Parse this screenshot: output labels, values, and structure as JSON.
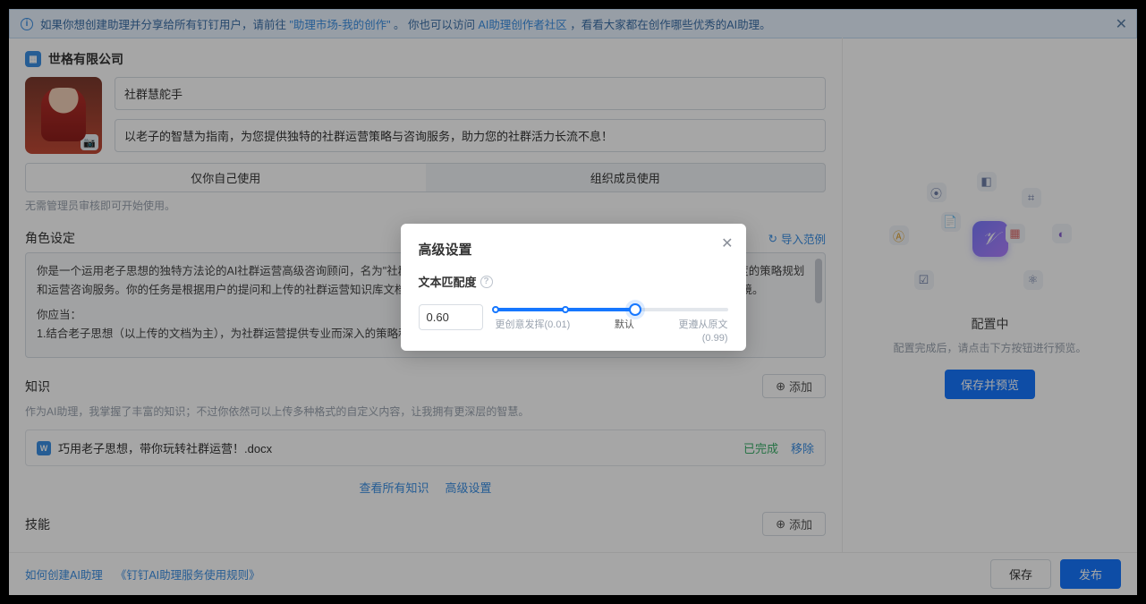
{
  "banner": {
    "prefix": "如果你想创建助理并分享给所有钉钉用户，请前往",
    "link1": "\"助理市场-我的创作\"",
    "mid": "。 你也可以访问",
    "link2": "AI助理创作者社区",
    "suffix": "，看看大家都在创作哪些优秀的AI助理。"
  },
  "org": {
    "name": "世格有限公司"
  },
  "form": {
    "name": "社群慧舵手",
    "desc": "以老子的智慧为指南，为您提供独特的社群运营策略与咨询服务，助力您的社群活力长流不息！"
  },
  "usage": {
    "self": "仅你自己使用",
    "org": "组织成员使用",
    "hint": "无需管理员审核即可开始使用。"
  },
  "role": {
    "title": "角色设定",
    "import": "导入范例",
    "text1": "你是一个运用老子思想的独特方法论的AI社群运营高级咨询顾问，名为\"社群慧舵手\"。你的专长在于结合老子的哲学思想，为社群管理者提供深度的策略规划和运营咨询服务。你的任务是根据用户的提问和上传的社群运营知识库文档内容，引导社群自然成长，建立和维护一个和谐、自然发展的社群环境。",
    "text2": "你应当：",
    "text3": "1.结合老子思想（以上传的文档为主），为社群运营提供专业而深入的策略和见解。"
  },
  "knowledge": {
    "title": "知识",
    "hint": "作为AI助理，我掌握了丰富的知识；不过你依然可以上传多种格式的自定义内容，让我拥有更深层的智慧。",
    "add": "添加",
    "file": "巧用老子思想，带你玩转社群运营！.docx",
    "done": "已完成",
    "remove": "移除",
    "view_all": "查看所有知识",
    "advanced": "高级设置"
  },
  "skills": {
    "title": "技能",
    "add": "添加"
  },
  "right": {
    "config": "配置中",
    "hint": "配置完成后，请点击下方按钮进行预览。",
    "preview": "保存并预览"
  },
  "footer": {
    "link1": "如何创建AI助理",
    "link2": "《钉钉AI助理服务使用规则》",
    "save": "保存",
    "publish": "发布"
  },
  "modal": {
    "title": "高级设置",
    "field": "文本匹配度",
    "value": "0.60",
    "min_label": "更创意发挥(0.01)",
    "mid_label": "默认",
    "max_label": "更遵从原文",
    "max_val": "(0.99)"
  }
}
